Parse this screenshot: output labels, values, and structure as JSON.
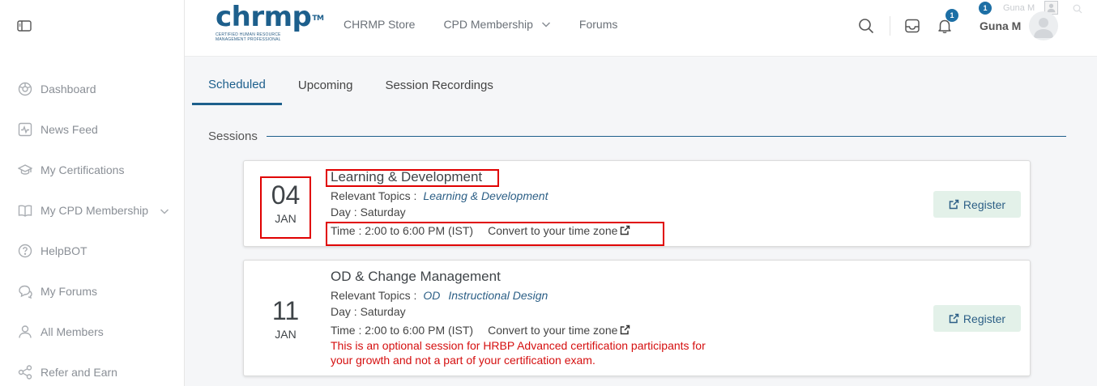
{
  "logo": {
    "text": "chrmp",
    "tm": "TM",
    "subtitle_1": "CERTIFIED HUMAN RESOURCE",
    "subtitle_2": "MANAGEMENT PROFESSIONAL"
  },
  "topnav": {
    "store": "CHRMP Store",
    "cpd": "CPD Membership",
    "forums": "Forums"
  },
  "header": {
    "bell_badge": "1",
    "user_badge": "1",
    "user_name": "Guna M",
    "user_faint": "Guna M"
  },
  "sidebar": {
    "items": [
      {
        "label": "Dashboard"
      },
      {
        "label": "News Feed"
      },
      {
        "label": "My Certifications"
      },
      {
        "label": "My CPD Membership"
      },
      {
        "label": "HelpBOT"
      },
      {
        "label": "My Forums"
      },
      {
        "label": "All Members"
      },
      {
        "label": "Refer and Earn"
      }
    ]
  },
  "tabs": {
    "scheduled": "Scheduled",
    "upcoming": "Upcoming",
    "recordings": "Session Recordings"
  },
  "sessions_title": "Sessions",
  "sessions": [
    {
      "day": "04",
      "month": "JAN",
      "title": "Learning & Development",
      "topics_label": "Relevant Topics :",
      "topics": [
        "Learning & Development"
      ],
      "day_label": "Day : Saturday",
      "time_label": "Time : 2:00 to 6:00 PM (IST)",
      "tz_label": "Convert to your time zone",
      "register_label": "Register"
    },
    {
      "day": "11",
      "month": "JAN",
      "title": "OD & Change Management",
      "topics_label": "Relevant Topics :",
      "topics": [
        "OD",
        "Instructional Design"
      ],
      "day_label": "Day : Saturday",
      "time_label": "Time : 2:00 to 6:00 PM (IST)",
      "tz_label": "Convert to your time zone",
      "note_1": "This is an optional session for HRBP Advanced certification participants for",
      "note_2": "your growth and not a part of your certification exam.",
      "register_label": "Register"
    }
  ],
  "colors": {
    "brand": "#1d5f8c",
    "register_bg": "#e3f1e9",
    "note": "#d50f0f",
    "highlight": "#e00000"
  }
}
